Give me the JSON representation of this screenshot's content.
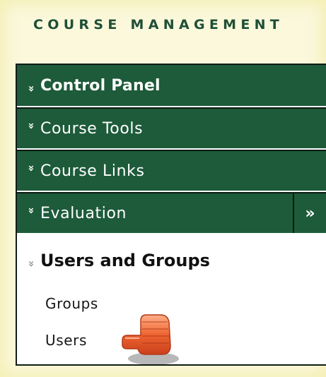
{
  "heading": "COURSE MANAGEMENT",
  "menu": [
    {
      "arrow": "«",
      "label": "Control Panel",
      "bold": true
    },
    {
      "arrow": "»",
      "label": "Course Tools",
      "bold": false
    },
    {
      "arrow": "»",
      "label": "Course Links",
      "bold": false
    },
    {
      "arrow": "»",
      "label": "Evaluation",
      "bold": false,
      "side": "»"
    }
  ],
  "section": {
    "arrow": "«",
    "label": "Users and Groups",
    "items": [
      "Groups",
      "Users"
    ]
  },
  "colors": {
    "menu_bg": "#1d5b3a",
    "heading": "#1f4f37",
    "background": "#fbf8dc",
    "pointer": "#e8572a"
  },
  "icons": {
    "pointer": "pointing-hand-icon"
  }
}
